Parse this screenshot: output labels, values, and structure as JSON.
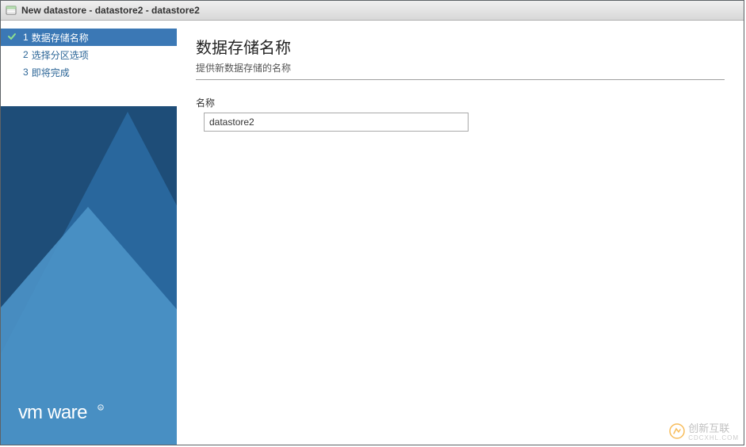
{
  "window": {
    "title": "New datastore - datastore2 - datastore2"
  },
  "sidebar": {
    "steps": [
      {
        "num": "1",
        "label": "数据存储名称",
        "active": true,
        "checked": true
      },
      {
        "num": "2",
        "label": "选择分区选项",
        "active": false,
        "checked": false
      },
      {
        "num": "3",
        "label": "即将完成",
        "active": false,
        "checked": false
      }
    ],
    "logo": "vmware"
  },
  "content": {
    "heading": "数据存储名称",
    "subtitle": "提供新数据存储的名称",
    "name_label": "名称",
    "name_value": "datastore2"
  },
  "watermark": {
    "brand": "创新互联",
    "sub": "CDCXHL.COM"
  }
}
